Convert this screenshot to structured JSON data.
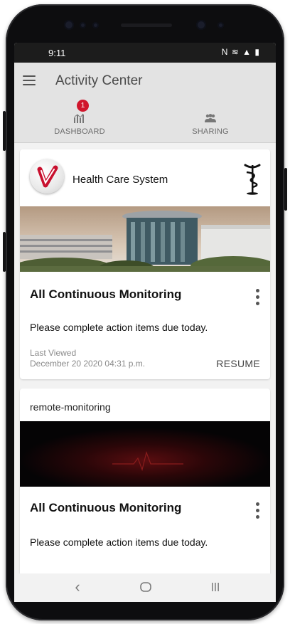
{
  "status_bar": {
    "time": "9:11",
    "icons": [
      "nfc-icon",
      "wifi-icon",
      "signal-icon",
      "battery-icon"
    ]
  },
  "app_bar": {
    "title": "Activity Center",
    "menu_icon": "hamburger-menu-icon"
  },
  "tabs": [
    {
      "label": "DASHBOARD",
      "icon": "dashboard-chart-icon",
      "badge": "1"
    },
    {
      "label": "SHARING",
      "icon": "people-group-icon"
    }
  ],
  "cards": [
    {
      "org_name": "Health Care System",
      "logo": "heart-check-logo",
      "emblem": "caduceus-icon",
      "title": "All Continuous Monitoring",
      "description": "Please complete action items due today.",
      "last_viewed_label": "Last Viewed",
      "last_viewed_value": "December 20 2020 04:31 p.m.",
      "action_label": "RESUME"
    },
    {
      "org_name": "remote-monitoring",
      "title": "All Continuous Monitoring",
      "description": "Please complete action items due today."
    }
  ],
  "nav_bar": {
    "back_icon": "back-chevron-icon",
    "home_icon": "home-circle-icon",
    "recents_icon": "recents-icon"
  },
  "colors": {
    "badge": "#d0162c",
    "app_bar_bg": "#e3e3e3",
    "status_bar_bg": "#1c1c1c",
    "screen_bg": "#f2f2f2"
  }
}
